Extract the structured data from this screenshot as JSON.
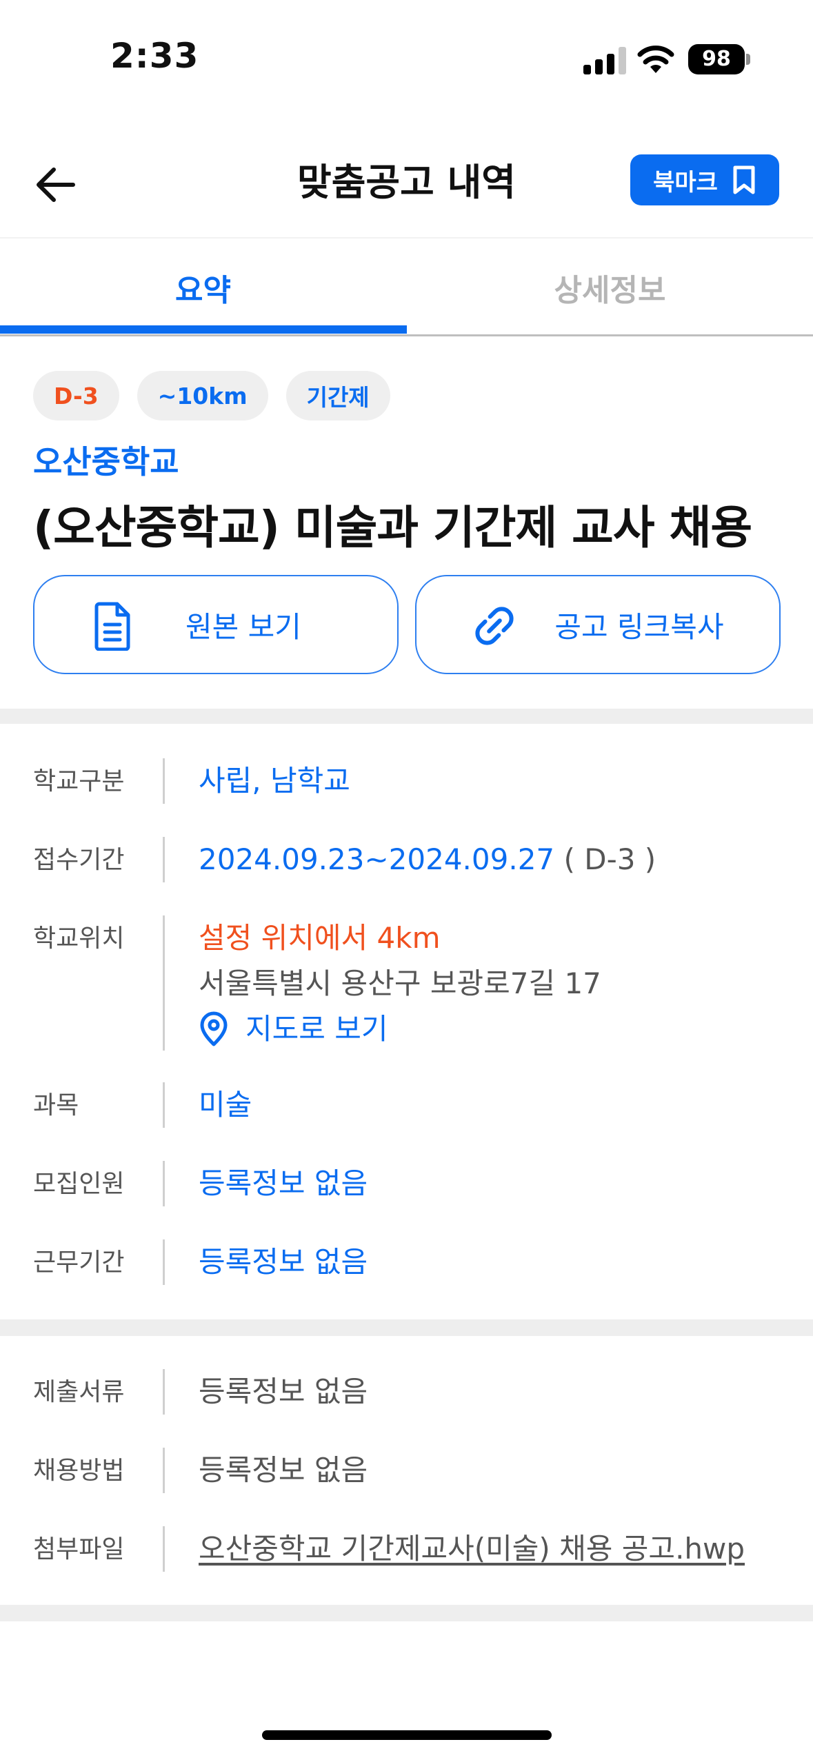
{
  "status_bar": {
    "time": "2:33",
    "battery": "98"
  },
  "header": {
    "title": "맞춤공고 내역",
    "bookmark_label": "북마크"
  },
  "tabs": [
    {
      "label": "요약",
      "active": true
    },
    {
      "label": "상세정보",
      "active": false
    }
  ],
  "tags": {
    "deadline": "D-3",
    "distance": "~10km",
    "type": "기간제"
  },
  "school_name": "오산중학교",
  "job_title": "(오산중학교) 미술과 기간제 교사 채용",
  "actions": {
    "view_original": "원본 보기",
    "copy_link": "공고 링크복사"
  },
  "info": {
    "school_type": {
      "label": "학교구분",
      "value": "사립, 남학교"
    },
    "application_period": {
      "label": "접수기간",
      "value": "2024.09.23~2024.09.27",
      "dday": "( D-3 )"
    },
    "school_location": {
      "label": "학교위치",
      "distance": "설정 위치에서 4km",
      "address": "서울특별시 용산구 보광로7길 17",
      "map_link": "지도로 보기"
    },
    "subject": {
      "label": "과목",
      "value": "미술"
    },
    "recruit_count": {
      "label": "모집인원",
      "value": "등록정보 없음"
    },
    "work_period": {
      "label": "근무기간",
      "value": "등록정보 없음"
    },
    "documents": {
      "label": "제출서류",
      "value": "등록정보 없음"
    },
    "hiring_method": {
      "label": "채용방법",
      "value": "등록정보 없음"
    },
    "attachment": {
      "label": "첨부파일",
      "value": "오산중학교 기간제교사(미술) 채용 공고.hwp"
    }
  },
  "colors": {
    "accent": "#0a6cf0",
    "warning": "#f0501e",
    "divider": "#eeeeee"
  }
}
